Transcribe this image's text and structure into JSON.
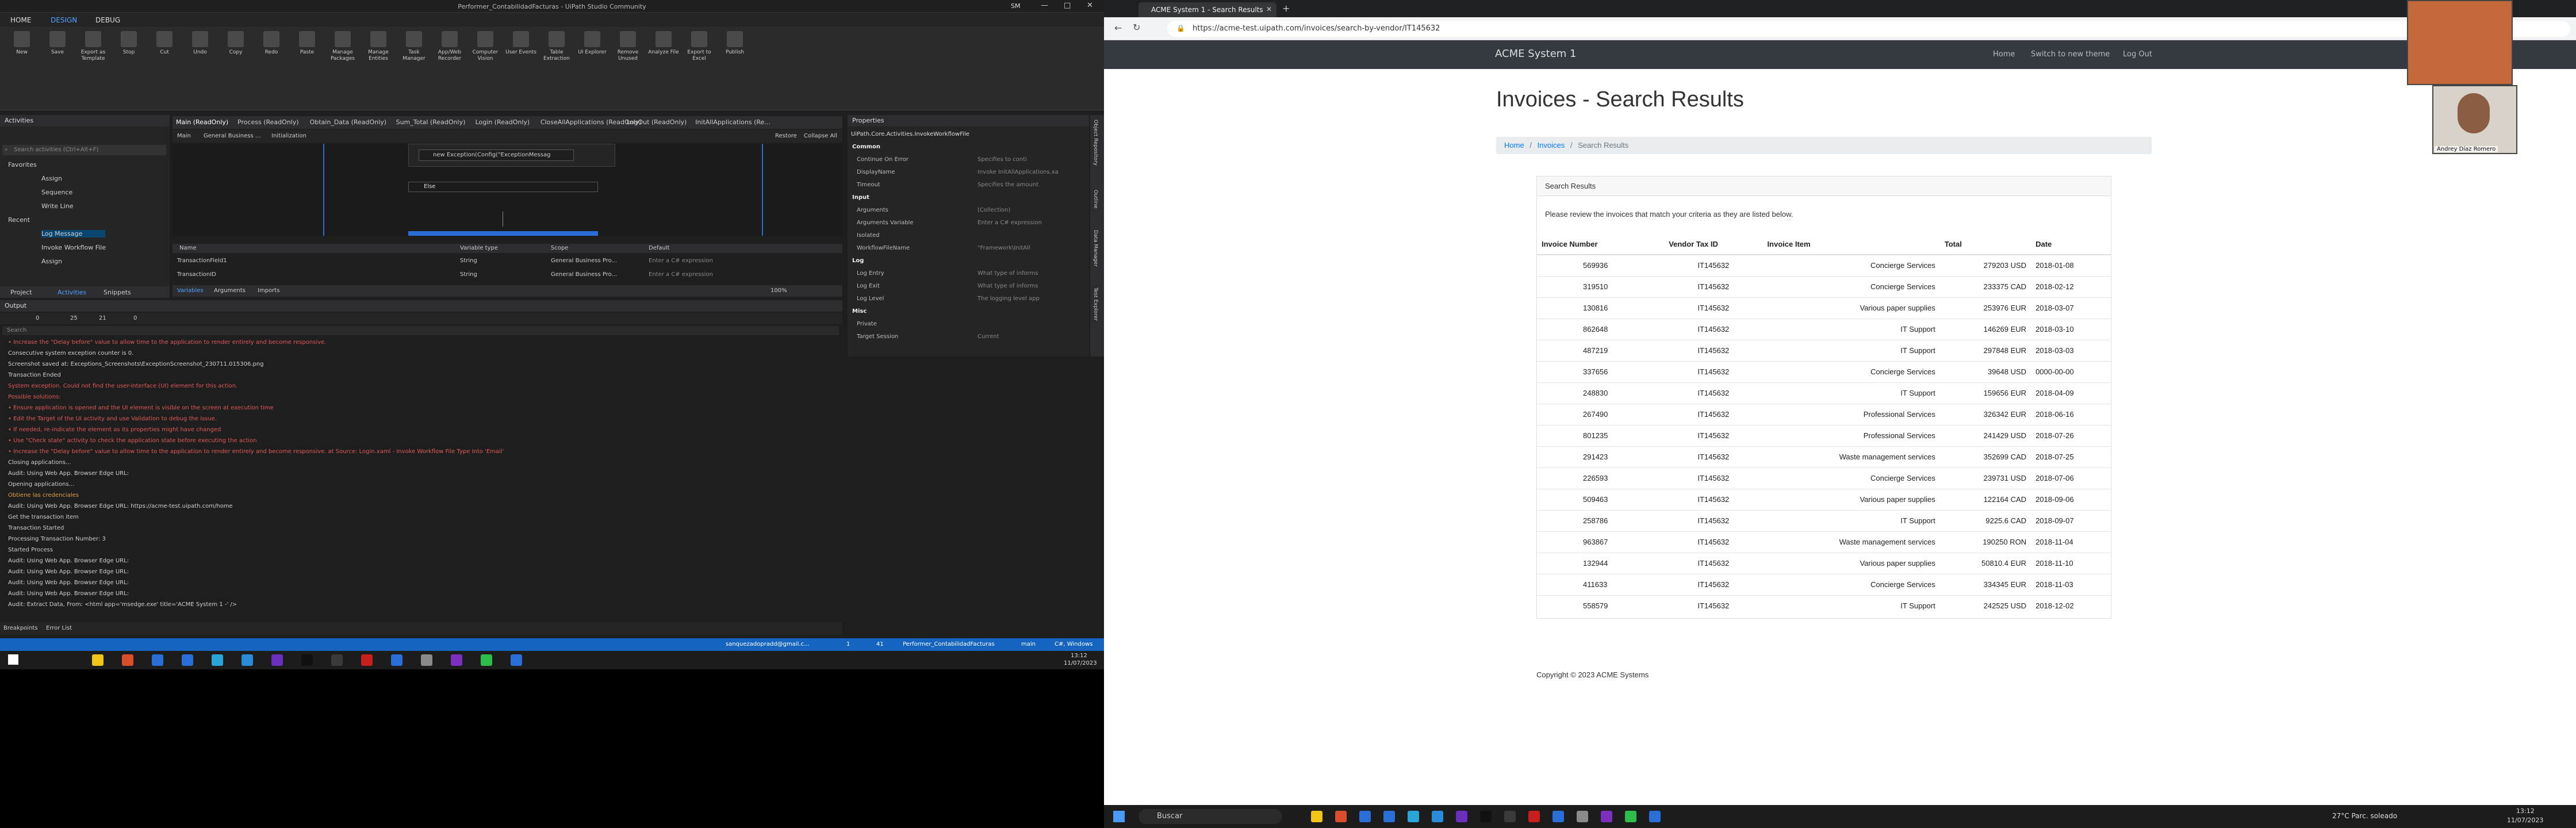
{
  "studio": {
    "window_title": "Performer_ContabilidadFacturas - UiPath Studio Community",
    "user_initials": "SM",
    "menu": [
      "HOME",
      "DESIGN",
      "DEBUG"
    ],
    "ribbon": [
      "New",
      "Save",
      "Export as Template",
      "Stop",
      "Cut",
      "Undo",
      "Copy",
      "Redo",
      "Paste",
      "Manage Packages",
      "Manage Entities",
      "Task Manager",
      "App/Web Recorder",
      "Computer Vision",
      "User Events",
      "Table Extraction",
      "UI Explorer",
      "Remove Unused",
      "Analyze File",
      "Export to Excel",
      "Publish"
    ],
    "activities": {
      "title": "Activities",
      "search_placeholder": "Search activities (Ctrl+Alt+F)",
      "favorites_label": "Favorites",
      "favorites": [
        "Assign",
        "Sequence",
        "Write Line"
      ],
      "recent_label": "Recent",
      "recent": [
        "Log Message",
        "Invoke Workflow File",
        "Assign"
      ],
      "bottom_tabs": [
        "Project",
        "Activities",
        "Snippets"
      ]
    },
    "doc_tabs": [
      "Main (ReadOnly)",
      "Process (ReadOnly)",
      "Obtain_Data (ReadOnly)",
      "Sum_Total (ReadOnly)",
      "Login (ReadOnly)",
      "CloseAllApplications (ReadOnly)",
      "LogOut (ReadOnly)",
      "InitAllApplications (Re..."
    ],
    "breadcrumb": [
      "Main",
      "General Business ...",
      "Initialization"
    ],
    "restore_label": "Restore",
    "collapse_label": "Collapse All",
    "catch_expr": "new Exception(Config(\"ExceptionMessag",
    "else_label": "Else",
    "variables": {
      "headers": [
        "Name",
        "Variable type",
        "Scope",
        "Default"
      ],
      "rows": [
        {
          "name": "TransactionField1",
          "type": "String",
          "scope": "General Business Pro...",
          "default": "Enter a C# expression"
        },
        {
          "name": "TransactionID",
          "type": "String",
          "scope": "General Business Pro...",
          "default": "Enter a C# expression"
        }
      ],
      "tabs": [
        "Variables",
        "Arguments",
        "Imports"
      ],
      "zoom": "100%"
    },
    "output": {
      "title": "Output",
      "counts": [
        "0",
        "25",
        "21",
        "0"
      ],
      "search_placeholder": "Search",
      "lines": [
        {
          "t": "• Increase the \"Delay before\" value to allow time to the application to render entirely and become responsive.",
          "c": "red"
        },
        {
          "t": "Consecutive system exception counter is 0.",
          "c": "wh"
        },
        {
          "t": "Screenshot saved at: Exceptions_Screenshots\\ExceptionScreenshot_230711.015306.png",
          "c": "wh"
        },
        {
          "t": "Transaction Ended",
          "c": "wh"
        },
        {
          "t": "System exception. Could not find the user-interface (UI) element for this action.",
          "c": "red"
        },
        {
          "t": "Possible solutions:",
          "c": "red"
        },
        {
          "t": "• Ensure application is opened and the UI element is visible on the screen at execution time",
          "c": "red"
        },
        {
          "t": "• Edit the Target of the UI activity and use Validation to debug the issue.",
          "c": "red"
        },
        {
          "t": "• If needed, re-indicate the element as its properties might have changed",
          "c": "red"
        },
        {
          "t": "• Use \"Check state\" activity to check the application state before executing the action",
          "c": "red"
        },
        {
          "t": "• Increase the \"Delay before\" value to allow time to the application to render entirely and become responsive. at Source: Login.xaml - Invoke Workflow File Type Into 'Email'",
          "c": "red"
        },
        {
          "t": "Closing applications...",
          "c": "wh"
        },
        {
          "t": "Audit: Using Web App. Browser Edge URL:",
          "c": "wh"
        },
        {
          "t": "Opening applications...",
          "c": "wh"
        },
        {
          "t": "Obtiene las credenciales",
          "c": "yel"
        },
        {
          "t": "Audit: Using Web App. Browser Edge URL: https://acme-test.uipath.com/home",
          "c": "wh"
        },
        {
          "t": "Get the transaction item",
          "c": "wh"
        },
        {
          "t": "Transaction Started",
          "c": "wh"
        },
        {
          "t": "Processing Transaction Number: 3",
          "c": "wh"
        },
        {
          "t": "Started Process",
          "c": "wh"
        },
        {
          "t": "Audit: Using Web App. Browser Edge URL:",
          "c": "wh"
        },
        {
          "t": "Audit: Using Web App. Browser Edge URL:",
          "c": "wh"
        },
        {
          "t": "Audit: Using Web App. Browser Edge URL:",
          "c": "wh"
        },
        {
          "t": "Audit: Using Web App. Browser Edge URL:",
          "c": "wh"
        },
        {
          "t": "Audit: Extract Data, From: <html app='msedge.exe' title='ACME System 1 -' />",
          "c": "wh"
        }
      ],
      "bottom_tabs": [
        "Breakpoints",
        "Error List"
      ]
    },
    "properties": {
      "title": "Properties",
      "activity": "UiPath.Core.Activities.InvokeWorkflowFile",
      "rows": [
        {
          "k": "Common",
          "v": "",
          "h": true
        },
        {
          "k": "Continue On Error",
          "v": "Specifies to conti"
        },
        {
          "k": "DisplayName",
          "v": "Invoke InitAllApplications.xa"
        },
        {
          "k": "Timeout",
          "v": "Specifies the amount"
        },
        {
          "k": "Input",
          "v": "",
          "h": true
        },
        {
          "k": "Arguments",
          "v": "(Collection)"
        },
        {
          "k": "Arguments Variable",
          "v": "Enter a C# expression"
        },
        {
          "k": "Isolated",
          "v": ""
        },
        {
          "k": "WorkflowFileName",
          "v": "\"Framework\\InitAll"
        },
        {
          "k": "Log",
          "v": "",
          "h": true
        },
        {
          "k": "Log Entry",
          "v": "What type of informs"
        },
        {
          "k": "Log Exit",
          "v": "What type of informs"
        },
        {
          "k": "Log Level",
          "v": "The logging level app"
        },
        {
          "k": "Misc",
          "v": "",
          "h": true
        },
        {
          "k": "Private",
          "v": ""
        },
        {
          "k": "Target Session",
          "v": "Current"
        }
      ]
    },
    "side_tabs": [
      "Object Repository",
      "Outline",
      "Data Manager",
      "Test Explorer"
    ],
    "status": {
      "user": "sanquezadopradd@gmail.c...",
      "up": "1",
      "errors": "41",
      "project": "Performer_ContabilidadFacturas",
      "branch": "main",
      "lang": "C#, Windows"
    },
    "clock": {
      "time": "13:12",
      "date": "11/07/2023"
    }
  },
  "browser": {
    "tab_title": "ACME System 1 - Search Results",
    "url": "https://acme-test.uipath.com/invoices/search-by-vendor/IT145632",
    "brand": "ACME System 1",
    "nav": [
      "Home",
      "Switch to new theme",
      "Log Out"
    ],
    "page_title": "Invoices - Search Results",
    "breadcrumb": [
      "Home",
      "Invoices",
      "Search Results"
    ],
    "card_title": "Search Results",
    "intro": "Please review the invoices that match your criteria as they are listed below.",
    "table_headers": [
      "Invoice Number",
      "Vendor Tax ID",
      "Invoice Item",
      "Total",
      "Date"
    ],
    "rows": [
      [
        "569936",
        "IT145632",
        "Concierge Services",
        "279203 USD",
        "2018-01-08"
      ],
      [
        "319510",
        "IT145632",
        "Concierge Services",
        "233375 CAD",
        "2018-02-12"
      ],
      [
        "130816",
        "IT145632",
        "Various paper supplies",
        "253976 EUR",
        "2018-03-07"
      ],
      [
        "862648",
        "IT145632",
        "IT Support",
        "146269 EUR",
        "2018-03-10"
      ],
      [
        "487219",
        "IT145632",
        "IT Support",
        "297848 EUR",
        "2018-03-03"
      ],
      [
        "337656",
        "IT145632",
        "Concierge Services",
        "39648 USD",
        "0000-00-00"
      ],
      [
        "248830",
        "IT145632",
        "IT Support",
        "159656 EUR",
        "2018-04-09"
      ],
      [
        "267490",
        "IT145632",
        "Professional Services",
        "326342 EUR",
        "2018-06-16"
      ],
      [
        "801235",
        "IT145632",
        "Professional Services",
        "241429 USD",
        "2018-07-26"
      ],
      [
        "291423",
        "IT145632",
        "Waste management services",
        "352699 CAD",
        "2018-07-25"
      ],
      [
        "226593",
        "IT145632",
        "Concierge Services",
        "239731 USD",
        "2018-07-06"
      ],
      [
        "509463",
        "IT145632",
        "Various paper supplies",
        "122164 CAD",
        "2018-09-06"
      ],
      [
        "258786",
        "IT145632",
        "IT Support",
        "9225.6 CAD",
        "2018-09-07"
      ],
      [
        "963867",
        "IT145632",
        "Waste management services",
        "190250 RON",
        "2018-11-04"
      ],
      [
        "132944",
        "IT145632",
        "Various paper supplies",
        "50810.4 EUR",
        "2018-11-10"
      ],
      [
        "411633",
        "IT145632",
        "Concierge Services",
        "334345 EUR",
        "2018-11-03"
      ],
      [
        "558579",
        "IT145632",
        "IT Support",
        "242525 USD",
        "2018-12-02"
      ]
    ],
    "footer": "Copyright © 2023 ACME Systems",
    "webcam_name": "Andrey Díaz Romero"
  },
  "taskbar": {
    "search": "Buscar",
    "weather": "27°C  Parc. soleado",
    "time": "13:12",
    "date": "11/07/2023"
  },
  "colors": {
    "studio_bg": "#1e1e1e",
    "status_bar": "#1565c0",
    "nav_dark": "#343a40",
    "link": "#007bff",
    "error_red": "#e05a5a"
  }
}
